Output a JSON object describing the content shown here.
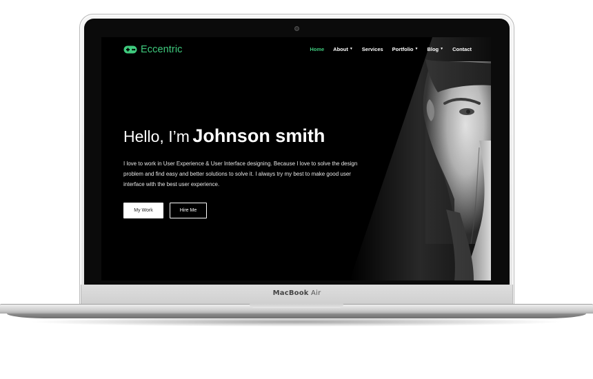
{
  "device": {
    "brand": "MacBook",
    "model": "Air"
  },
  "site": {
    "logo_text": "Eccentric",
    "logo_icon": "gamepad-icon",
    "accent_color": "#3fcb7e",
    "nav": [
      {
        "label": "Home",
        "active": true,
        "dropdown": false
      },
      {
        "label": "About",
        "active": false,
        "dropdown": true
      },
      {
        "label": "Services",
        "active": false,
        "dropdown": false
      },
      {
        "label": "Portfolio",
        "active": false,
        "dropdown": true
      },
      {
        "label": "Blog",
        "active": false,
        "dropdown": true
      },
      {
        "label": "Contact",
        "active": false,
        "dropdown": false
      }
    ],
    "caret_glyph": "▼",
    "hero": {
      "greeting": "Hello, I’m",
      "name": "Johnson smith",
      "description": "I love to work in User Experience & User Interface designing. Because I love to solve the design problem and find easy and better solutions to solve it. I always try my best to make good user interface with the best user experience.",
      "primary_button": "My Work",
      "secondary_button": "Hire Me"
    }
  }
}
